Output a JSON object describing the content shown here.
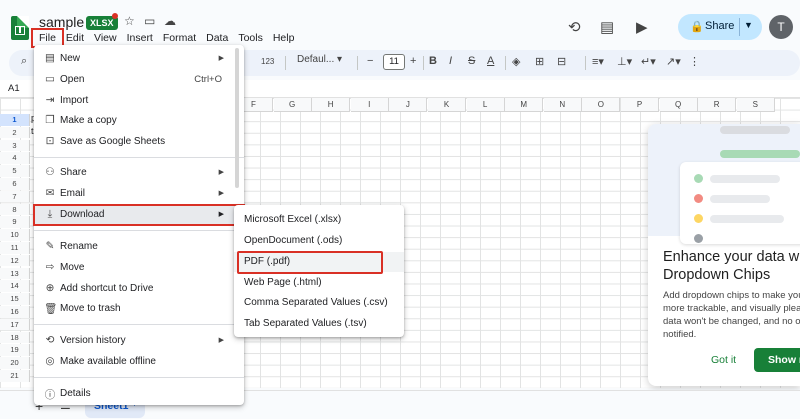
{
  "app": {
    "doc_title": "sample",
    "file_badge": "XLSX",
    "menus": [
      "File",
      "Edit",
      "View",
      "Insert",
      "Format",
      "Data",
      "Tools",
      "Help"
    ],
    "share_label": "Share",
    "avatar_initial": "T"
  },
  "toolbar": {
    "number_format": "123",
    "font": "Defaul...",
    "font_size": "11"
  },
  "formula_bar": {
    "cell_ref": "A1"
  },
  "grid": {
    "columns": [
      "F",
      "G",
      "H",
      "I",
      "J",
      "K",
      "L",
      "M",
      "N",
      "O",
      "P",
      "Q",
      "R",
      "S"
    ],
    "rows": [
      "1",
      "2",
      "3",
      "4",
      "5",
      "6",
      "7",
      "8",
      "9",
      "10",
      "11",
      "12",
      "13",
      "14",
      "15",
      "16",
      "17",
      "18",
      "19",
      "20",
      "21"
    ],
    "visible_cell_fragment_1": "p",
    "visible_cell_fragment_2": "t"
  },
  "file_menu": {
    "items": [
      {
        "icon": "new-icon",
        "label": "New",
        "submenu": true
      },
      {
        "icon": "open-icon",
        "label": "Open",
        "shortcut": "Ctrl+O"
      },
      {
        "icon": "import-icon",
        "label": "Import"
      },
      {
        "icon": "copy-icon",
        "label": "Make a copy"
      },
      {
        "icon": "save-sheets-icon",
        "label": "Save as Google Sheets"
      },
      {
        "icon": "share-icon",
        "label": "Share",
        "submenu": true
      },
      {
        "icon": "email-icon",
        "label": "Email",
        "submenu": true
      },
      {
        "icon": "download-icon",
        "label": "Download",
        "submenu": true
      },
      {
        "icon": "rename-icon",
        "label": "Rename"
      },
      {
        "icon": "move-icon",
        "label": "Move"
      },
      {
        "icon": "shortcut-icon",
        "label": "Add shortcut to Drive"
      },
      {
        "icon": "trash-icon",
        "label": "Move to trash"
      },
      {
        "icon": "history-icon",
        "label": "Version history",
        "submenu": true
      },
      {
        "icon": "offline-icon",
        "label": "Make available offline"
      },
      {
        "icon": "info-icon",
        "label": "Details"
      }
    ]
  },
  "download_menu": {
    "items": [
      "Microsoft Excel (.xlsx)",
      "OpenDocument (.ods)",
      "PDF (.pdf)",
      "Web Page (.html)",
      "Comma Separated Values (.csv)",
      "Tab Separated Values (.tsv)"
    ]
  },
  "promo": {
    "title": "Enhance your data w\nDropdown Chips",
    "body": "Add dropdown chips to make you\nmore trackable, and visually plea\ndata won't be changed, and no o\nnotified.",
    "dismiss_label": "Got it",
    "action_label": "Show m"
  },
  "sheets": {
    "active": "Sheet1"
  },
  "colors": {
    "accent_green": "#188038",
    "share_bg": "#c2e7ff",
    "highlight_red": "#d93025",
    "active_blue": "#0b57d0"
  }
}
